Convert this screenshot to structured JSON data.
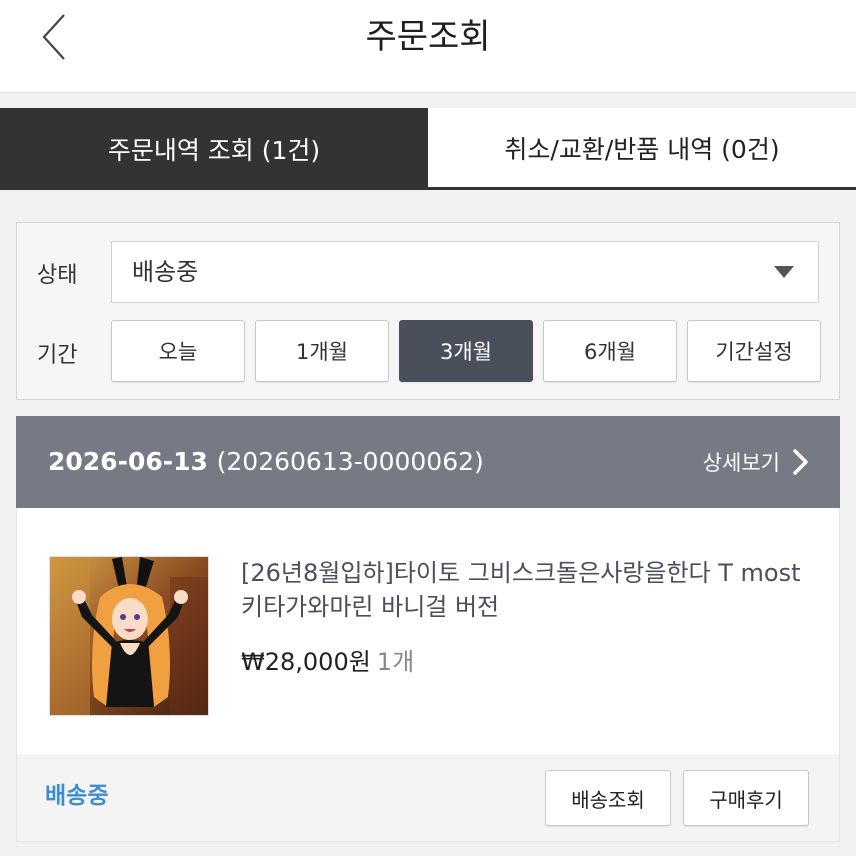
{
  "header": {
    "title": "주문조회",
    "back_icon": "chevron-left-icon"
  },
  "tabs": [
    {
      "label": "주문내역 조회  (1건)",
      "active": true
    },
    {
      "label": "취소/교환/반품 내역  (0건)",
      "active": false
    }
  ],
  "filter": {
    "status_label": "상태",
    "status_value": "배송중",
    "period_label": "기간",
    "periods": [
      "오늘",
      "1개월",
      "3개월",
      "6개월",
      "기간설정"
    ],
    "selected_period": "3개월"
  },
  "order": {
    "date": "2026-06-13",
    "order_no": "(20260613-0000062)",
    "detail_label": "상세보기",
    "product_title": "[26년8월입하]타이토 그비스크돌은사랑을한다 T most 키타가와마린 바니걸 버전",
    "price": "₩28,000원",
    "quantity": "1개",
    "status": "배송중",
    "buttons": [
      "배송조회",
      "구매후기"
    ]
  },
  "colors": {
    "active_tab": "#333333",
    "selected_period": "#4a4f5c",
    "order_header": "#757a84",
    "status_blue": "#3d8bd6"
  }
}
